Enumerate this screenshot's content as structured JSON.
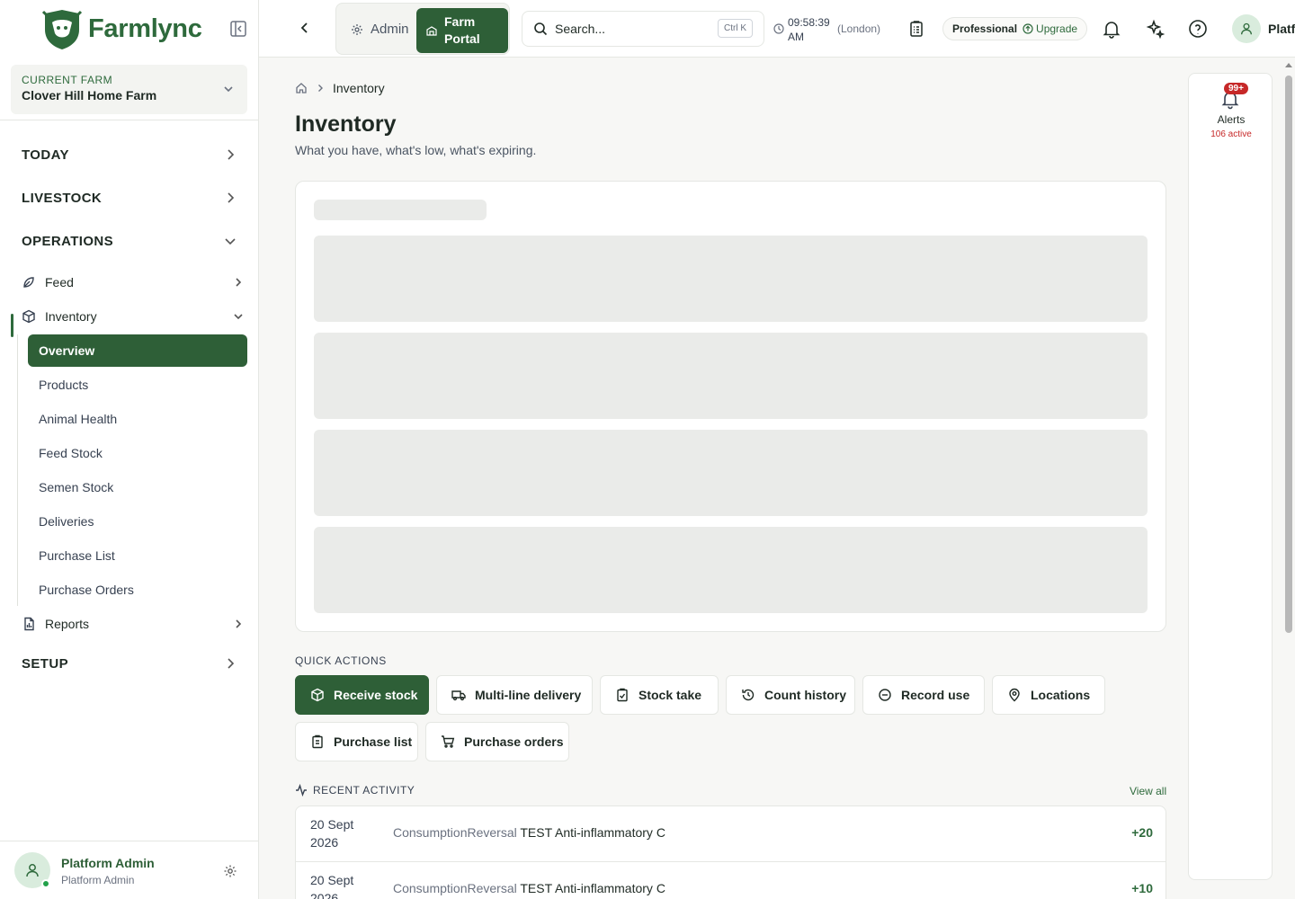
{
  "brand": {
    "name": "Farmlync"
  },
  "farm": {
    "label": "CURRENT FARM",
    "name": "Clover Hill Home Farm"
  },
  "nav": {
    "sections": {
      "today": "TODAY",
      "livestock": "LIVESTOCK",
      "operations": "OPERATIONS",
      "setup": "SETUP"
    },
    "feed": "Feed",
    "inventory": "Inventory",
    "reports": "Reports",
    "sub": [
      "Overview",
      "Products",
      "Animal Health",
      "Feed Stock",
      "Semen Stock",
      "Deliveries",
      "Purchase List",
      "Purchase Orders"
    ]
  },
  "user": {
    "name": "Platform Admin",
    "role": "Platform Admin"
  },
  "topbar": {
    "admin": "Admin",
    "farm_portal": "Farm Portal",
    "search_placeholder": "Search...",
    "shortcut": "Ctrl K",
    "time": "09:58:39 AM",
    "timezone": "(London)",
    "plan": "Professional",
    "upgrade": "Upgrade",
    "user_short": "Platf"
  },
  "breadcrumb": {
    "current": "Inventory"
  },
  "page": {
    "title": "Inventory",
    "subtitle": "What you have, what's low, what's expiring."
  },
  "quick_actions": {
    "title": "QUICK ACTIONS",
    "buttons": [
      "Receive stock",
      "Multi-line delivery",
      "Stock take",
      "Count history",
      "Record use",
      "Locations",
      "Purchase list",
      "Purchase orders"
    ]
  },
  "recent_activity": {
    "title": "RECENT ACTIVITY",
    "view_all": "View all",
    "rows": [
      {
        "date": "20 Sept 2026",
        "type": "ConsumptionReversal",
        "product": "TEST Anti-inflammatory C",
        "amount": "+20"
      },
      {
        "date": "20 Sept 2026",
        "type": "ConsumptionReversal",
        "product": "TEST Anti-inflammatory C",
        "amount": "+10"
      }
    ]
  },
  "alerts": {
    "badge": "99+",
    "label": "Alerts",
    "count": "106 active"
  },
  "colors": {
    "brand": "#2e5f37",
    "accent": "#2e6a3c",
    "danger": "#c62828"
  }
}
